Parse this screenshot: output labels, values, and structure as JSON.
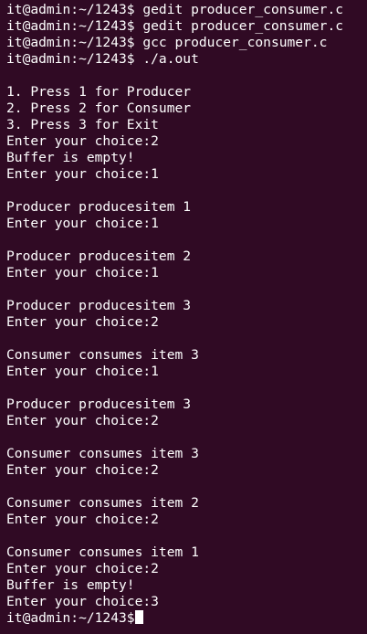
{
  "terminal": {
    "prompt": "it@admin:~/1243$",
    "lines": [
      "it@admin:~/1243$ gedit producer_consumer.c",
      "it@admin:~/1243$ gedit producer_consumer.c",
      "it@admin:~/1243$ gcc producer_consumer.c",
      "it@admin:~/1243$ ./a.out",
      "",
      "1. Press 1 for Producer",
      "2. Press 2 for Consumer",
      "3. Press 3 for Exit",
      "Enter your choice:2",
      "Buffer is empty!",
      "Enter your choice:1",
      "",
      "Producer producesitem 1",
      "Enter your choice:1",
      "",
      "Producer producesitem 2",
      "Enter your choice:1",
      "",
      "Producer producesitem 3",
      "Enter your choice:2",
      "",
      "Consumer consumes item 3",
      "Enter your choice:1",
      "",
      "Producer producesitem 3",
      "Enter your choice:2",
      "",
      "Consumer consumes item 3",
      "Enter your choice:2",
      "",
      "Consumer consumes item 2",
      "Enter your choice:2",
      "",
      "Consumer consumes item 1",
      "Enter your choice:2",
      "Buffer is empty!",
      "Enter your choice:3"
    ],
    "colors": {
      "background": "#300a24",
      "foreground": "#ffffff"
    }
  }
}
